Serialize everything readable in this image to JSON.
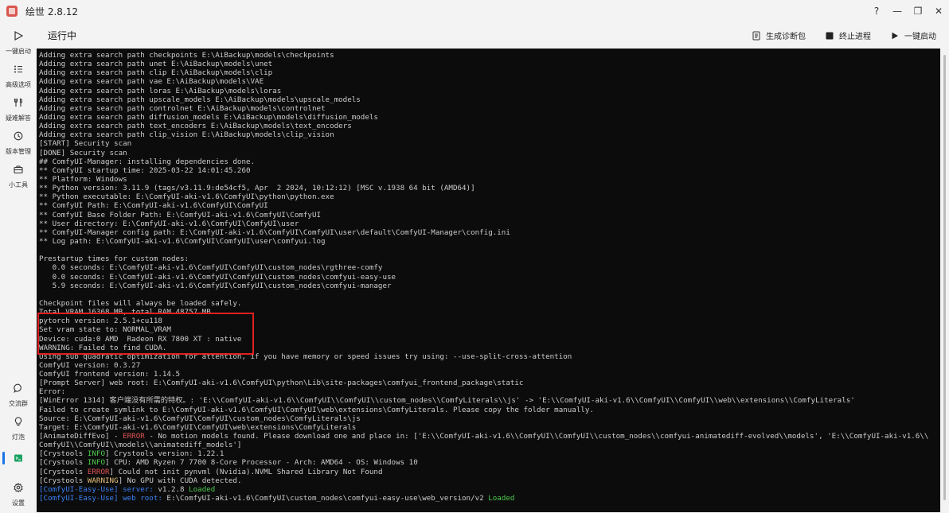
{
  "window": {
    "title": "绘世 2.8.12",
    "controls": {
      "help": "?",
      "minimize": "—",
      "restore": "❐",
      "close": "✕"
    }
  },
  "sidebar": {
    "items": [
      {
        "label": "一键启动",
        "icon": "play-icon"
      },
      {
        "label": "高级选项",
        "icon": "list-icon"
      },
      {
        "label": "疑难解答",
        "icon": "wrench-icon"
      },
      {
        "label": "版本管理",
        "icon": "history-icon"
      },
      {
        "label": "小工具",
        "icon": "toolbox-icon"
      },
      {
        "label": "交流群",
        "icon": "chat-icon"
      },
      {
        "label": "灯泡",
        "icon": "bulb-icon"
      },
      {
        "label": "",
        "icon": "console-icon"
      },
      {
        "label": "设置",
        "icon": "gear-icon"
      }
    ]
  },
  "header": {
    "title": "运行中",
    "actions": {
      "diagnostics": "生成诊断包",
      "stop": "终止进程",
      "start": "一键启动"
    }
  },
  "console": {
    "lines": [
      [
        {
          "t": "Adding extra search path checkpoints E:\\AiBackup\\models\\checkpoints"
        }
      ],
      [
        {
          "t": "Adding extra search path unet E:\\AiBackup\\models\\unet"
        }
      ],
      [
        {
          "t": "Adding extra search path clip E:\\AiBackup\\models\\clip"
        }
      ],
      [
        {
          "t": "Adding extra search path vae E:\\AiBackup\\models\\VAE"
        }
      ],
      [
        {
          "t": "Adding extra search path loras E:\\AiBackup\\models\\loras"
        }
      ],
      [
        {
          "t": "Adding extra search path upscale_models E:\\AiBackup\\models\\upscale_models"
        }
      ],
      [
        {
          "t": "Adding extra search path controlnet E:\\AiBackup\\models\\controlnet"
        }
      ],
      [
        {
          "t": "Adding extra search path diffusion_models E:\\AiBackup\\models\\diffusion_models"
        }
      ],
      [
        {
          "t": "Adding extra search path text_encoders E:\\AiBackup\\models\\text_encoders"
        }
      ],
      [
        {
          "t": "Adding extra search path clip_vision E:\\AiBackup\\models\\clip_vision"
        }
      ],
      [
        {
          "t": "[START] Security scan"
        }
      ],
      [
        {
          "t": "[DONE] Security scan"
        }
      ],
      [
        {
          "t": "## ComfyUI-Manager: installing dependencies done."
        }
      ],
      [
        {
          "t": "** ComfyUI startup time: 2025-03-22 14:01:45.260"
        }
      ],
      [
        {
          "t": "** Platform: Windows"
        }
      ],
      [
        {
          "t": "** Python version: 3.11.9 (tags/v3.11.9:de54cf5, Apr  2 2024, 10:12:12) [MSC v.1938 64 bit (AMD64)]"
        }
      ],
      [
        {
          "t": "** Python executable: E:\\ComfyUI-aki-v1.6\\ComfyUI\\python\\python.exe"
        }
      ],
      [
        {
          "t": "** ComfyUI Path: E:\\ComfyUI-aki-v1.6\\ComfyUI\\ComfyUI"
        }
      ],
      [
        {
          "t": "** ComfyUI Base Folder Path: E:\\ComfyUI-aki-v1.6\\ComfyUI\\ComfyUI"
        }
      ],
      [
        {
          "t": "** User directory: E:\\ComfyUI-aki-v1.6\\ComfyUI\\ComfyUI\\user"
        }
      ],
      [
        {
          "t": "** ComfyUI-Manager config path: E:\\ComfyUI-aki-v1.6\\ComfyUI\\ComfyUI\\user\\default\\ComfyUI-Manager\\config.ini"
        }
      ],
      [
        {
          "t": "** Log path: E:\\ComfyUI-aki-v1.6\\ComfyUI\\ComfyUI\\user\\comfyui.log"
        }
      ],
      [
        {
          "t": ""
        }
      ],
      [
        {
          "t": "Prestartup times for custom nodes:"
        }
      ],
      [
        {
          "t": "   0.0 seconds: E:\\ComfyUI-aki-v1.6\\ComfyUI\\ComfyUI\\custom_nodes\\rgthree-comfy"
        }
      ],
      [
        {
          "t": "   0.0 seconds: E:\\ComfyUI-aki-v1.6\\ComfyUI\\ComfyUI\\custom_nodes\\comfyui-easy-use"
        }
      ],
      [
        {
          "t": "   5.9 seconds: E:\\ComfyUI-aki-v1.6\\ComfyUI\\ComfyUI\\custom_nodes\\comfyui-manager"
        }
      ],
      [
        {
          "t": ""
        }
      ],
      [
        {
          "t": "Checkpoint files will always be loaded safely."
        }
      ],
      [
        {
          "t": "Total VRAM 16368 MB, total RAM 48757 MB"
        }
      ],
      [
        {
          "t": "pytorch version: 2.5.1+cu118"
        }
      ],
      [
        {
          "t": "Set vram state to: NORMAL_VRAM"
        }
      ],
      [
        {
          "t": "Device: cuda:0 AMD  Radeon RX 7800 XT : native"
        }
      ],
      [
        {
          "t": "WARNING: Failed to find CUDA."
        }
      ],
      [
        {
          "t": "Using sub quadratic optimization for attention, if you have memory or speed issues try using: --use-split-cross-attention"
        }
      ],
      [
        {
          "t": "ComfyUI version: 0.3.27"
        }
      ],
      [
        {
          "t": "ComfyUI frontend version: 1.14.5"
        }
      ],
      [
        {
          "t": "[Prompt Server] web root: E:\\ComfyUI-aki-v1.6\\ComfyUI\\python\\Lib\\site-packages\\comfyui_frontend_package\\static"
        }
      ],
      [
        {
          "t": "Error:"
        }
      ],
      [
        {
          "t": "[WinError 1314] 客户端没有所需的特权。: 'E:\\\\ComfyUI-aki-v1.6\\\\ComfyUI\\\\ComfyUI\\\\custom_nodes\\\\ComfyLiterals\\\\js' -> 'E:\\\\ComfyUI-aki-v1.6\\\\ComfyUI\\\\ComfyUI\\\\web\\\\extensions\\\\ComfyLiterals'"
        }
      ],
      [
        {
          "t": "Failed to create symlink to E:\\ComfyUI-aki-v1.6\\ComfyUI\\ComfyUI\\web\\extensions\\ComfyLiterals. Please copy the folder manually."
        }
      ],
      [
        {
          "t": "Source: E:\\ComfyUI-aki-v1.6\\ComfyUI\\ComfyUI\\custom_nodes\\ComfyLiterals\\js"
        }
      ],
      [
        {
          "t": "Target: E:\\ComfyUI-aki-v1.6\\ComfyUI\\ComfyUI\\web\\extensions\\ComfyLiterals"
        }
      ],
      [
        {
          "t": "[AnimateDiffEvo] - "
        },
        {
          "t": "ERROR",
          "c": "red"
        },
        {
          "t": " - No motion models found. Please download one and place in: ['E:\\\\ComfyUI-aki-v1.6\\\\ComfyUI\\\\ComfyUI\\\\custom_nodes\\\\comfyui-animatediff-evolved\\\\models', 'E:\\\\ComfyUI-aki-v1.6\\\\"
        }
      ],
      [
        {
          "t": "ComfyUI\\\\ComfyUI\\\\models\\\\animatediff_models']"
        }
      ],
      [
        {
          "t": "[Crystools "
        },
        {
          "t": "INFO",
          "c": "green"
        },
        {
          "t": "] Crystools version: 1.22.1"
        }
      ],
      [
        {
          "t": "[Crystools "
        },
        {
          "t": "INFO",
          "c": "green"
        },
        {
          "t": "] CPU: AMD Ryzen 7 7700 8-Core Processor - Arch: AMD64 - OS: Windows 10"
        }
      ],
      [
        {
          "t": "[Crystools "
        },
        {
          "t": "ERROR",
          "c": "red"
        },
        {
          "t": "] Could not init pynvml (Nvidia).NVML Shared Library Not Found"
        }
      ],
      [
        {
          "t": "[Crystools "
        },
        {
          "t": "WARNING",
          "c": "yellow"
        },
        {
          "t": "] No GPU with CUDA detected."
        }
      ],
      [
        {
          "t": "[ComfyUI-Easy-Use] server: ",
          "c": "blue"
        },
        {
          "t": "v1.2.8 "
        },
        {
          "t": "Loaded",
          "c": "green"
        }
      ],
      [
        {
          "t": "[ComfyUI-Easy-Use] web root: ",
          "c": "blue"
        },
        {
          "t": "E:\\ComfyUI-aki-v1.6\\ComfyUI\\custom_nodes\\comfyui-easy-use\\web_version/v2 "
        },
        {
          "t": "Loaded",
          "c": "green"
        }
      ]
    ]
  },
  "colors": {
    "console_bg": "#0c0c0c",
    "console_text": "#cccccc",
    "error": "#e05555",
    "info": "#4ec94e",
    "warning": "#e5c07b",
    "easyuse": "#3b82f6",
    "highlight_border": "#e02020"
  }
}
